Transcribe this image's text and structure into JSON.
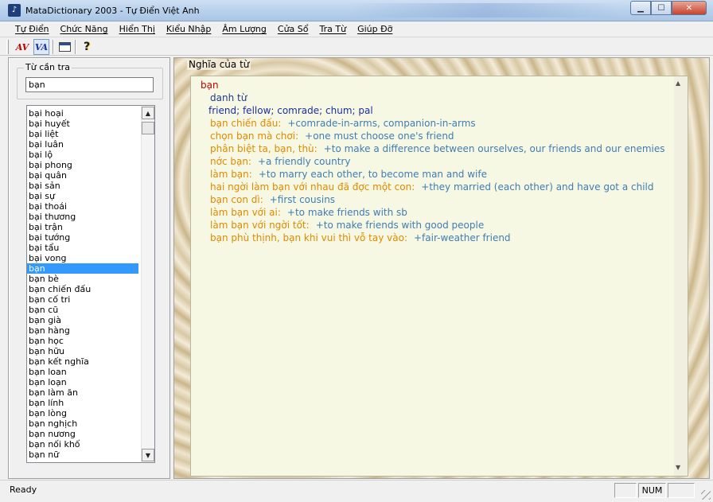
{
  "window": {
    "title": "MataDictionary 2003 - Tự Điển Việt Anh",
    "icon": "app-icon",
    "buttons": {
      "minimize": "minimize-icon",
      "maximize": "maximize-icon",
      "close": "close-icon"
    }
  },
  "menu": [
    "Tự Điển",
    "Chức Năng",
    "Hiển Thị",
    "Kiểu Nhập",
    "Âm Lượng",
    "Cửa Sổ",
    "Tra Từ",
    "Giúp Đỡ"
  ],
  "toolbar": {
    "av_label": "AV",
    "va_label": "VA",
    "help_label": "?"
  },
  "search": {
    "legend": "Từ cần tra",
    "value": "bạn"
  },
  "wordlist": {
    "items": [
      "bại hoại",
      "bại huyết",
      "bại liệt",
      "bại luân",
      "bại lộ",
      "bại phong",
      "bại quân",
      "bại sản",
      "bại sự",
      "bại thoái",
      "bại thương",
      "bại trận",
      "bại tướng",
      "bại tẩu",
      "bại vong",
      "bạn",
      "bạn bè",
      "bạn chiến đấu",
      "bạn cố tri",
      "bạn cũ",
      "bạn già",
      "bạn hàng",
      "bạn học",
      "bạn hữu",
      "bạn kết nghĩa",
      "bạn loan",
      "bạn loạn",
      "bạn làm ăn",
      "bạn lính",
      "bạn lòng",
      "bạn nghịch",
      "bạn nương",
      "bạn nối khố",
      "bạn nữ"
    ],
    "selected_index": 15
  },
  "meaning": {
    "panel_title": "Nghĩa của từ",
    "headword": "bạn",
    "part_of_speech": "danh từ",
    "translation": "friend; fellow; comrade; chum; pal",
    "examples": [
      {
        "vi": "bạn chiến đấu:",
        "en": "+comrade-in-arms, companion-in-arms"
      },
      {
        "vi": "chọn bạn mà chơi:",
        "en": "+one must choose one's friend"
      },
      {
        "vi": "phân biệt ta, bạn, thù:",
        "en": "+to make a difference between ourselves, our friends and our enemies"
      },
      {
        "vi": "nớc bạn:",
        "en": "+a friendly country"
      },
      {
        "vi": "làm bạn:",
        "en": "+to marry each other, to become man and wife"
      },
      {
        "vi": "hai ngời làm bạn với nhau đã đợc một con:",
        "en": "+they married (each other) and have got a child"
      },
      {
        "vi": "bạn con dì:",
        "en": "+first cousins"
      },
      {
        "vi": "làm bạn với ai:",
        "en": "+to make friends with sb"
      },
      {
        "vi": "làm bạn với ngời tốt:",
        "en": "+to make friends with good people"
      },
      {
        "vi": "bạn phù thịnh, bạn khi vui thì vỗ tay vào:",
        "en": "+fair-weather friend"
      }
    ]
  },
  "status": {
    "text": "Ready",
    "num": "NUM"
  },
  "colors": {
    "headword": "#c00000",
    "translation": "#1c2fa0",
    "example_vi": "#e08a00",
    "example_en": "#3f7db3",
    "selection": "#3399ff",
    "meaning_bg": "#f6f8e3"
  }
}
